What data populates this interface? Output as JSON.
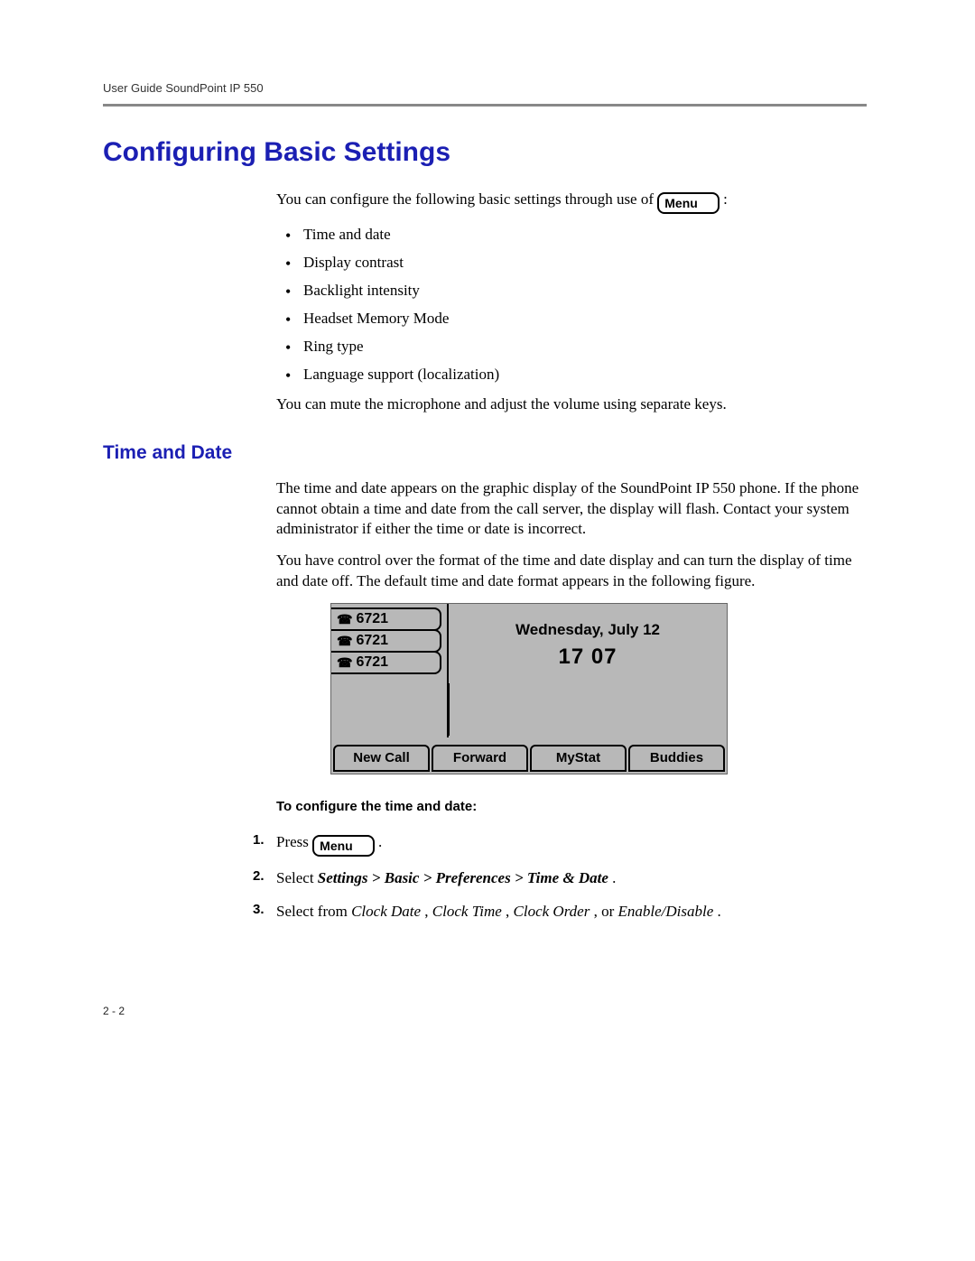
{
  "header": {
    "running_head": "User Guide SoundPoint IP 550"
  },
  "section": {
    "title": "Configuring Basic Settings",
    "intro_prefix": "You can configure the following basic settings through use of ",
    "menu_key_label": "Menu",
    "intro_suffix": " :",
    "bullets": [
      "Time and date",
      "Display contrast",
      "Backlight intensity",
      "Headset Memory Mode",
      "Ring type",
      "Language support (localization)"
    ],
    "after_bullets": "You can mute the microphone and adjust the volume using separate keys."
  },
  "subsection": {
    "title": "Time and Date",
    "para1": "The time and date appears on the graphic display of the SoundPoint IP 550 phone. If the phone cannot obtain a time and date from the call server, the display will flash. Contact your system administrator if either the time or date is incorrect.",
    "para2": "You have control over the format of the time and date display and can turn the display of time and date off. The default time and date format appears in the following figure."
  },
  "lcd": {
    "lines": [
      "6721",
      "6721",
      "6721"
    ],
    "date": "Wednesday, July 12",
    "time": "17 07",
    "softkeys": [
      "New Call",
      "Forward",
      "MyStat",
      "Buddies"
    ]
  },
  "procedure": {
    "heading": "To configure the time and date:",
    "steps": {
      "s1_prefix": "Press ",
      "s1_key": "Menu",
      "s1_suffix": " .",
      "s2_prefix": "Select ",
      "s2_path": "Settings > Basic > Preferences > Time & Date",
      "s2_suffix": ".",
      "s3_prefix": "Select from ",
      "s3_a": "Clock Date",
      "s3_sep1": ", ",
      "s3_b": "Clock Time",
      "s3_sep2": ", ",
      "s3_c": "Clock Order",
      "s3_sep3": ", or ",
      "s3_d": "Enable/Disable",
      "s3_suffix": "."
    }
  },
  "footer": {
    "page_number": "2 - 2"
  }
}
